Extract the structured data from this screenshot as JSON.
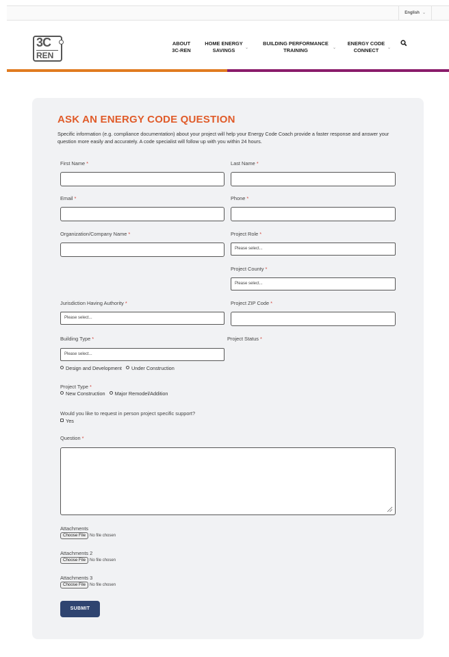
{
  "topbar": {
    "language": "English"
  },
  "header": {
    "logo": {
      "line1": "3C",
      "line2": "REN"
    },
    "nav": [
      {
        "line1": "ABOUT",
        "line2": "3C-REN"
      },
      {
        "line1": "HOME ENERGY",
        "line2": "SAVINGS"
      },
      {
        "line1": "BUILDING PERFORMANCE",
        "line2": "TRAINING"
      },
      {
        "line1": "ENERGY CODE",
        "line2": "CONNECT"
      }
    ]
  },
  "colors": {
    "accent_orange": "#e07b20",
    "accent_purple": "#8a1b6a",
    "title": "#e05b29",
    "submit": "#2f4470"
  },
  "form": {
    "title": "ASK AN ENERGY CODE QUESTION",
    "intro": "Specific information (e.g. compliance documentation) about your project will help your Energy Code Coach provide a faster response and answer your question more easily and accurately. A code specialist will follow up with you within 24 hours.",
    "required_mark": "*",
    "first_name": {
      "label": "First Name"
    },
    "last_name": {
      "label": "Last Name"
    },
    "email": {
      "label": "Email"
    },
    "phone": {
      "label": "Phone"
    },
    "organization": {
      "label": "Organization/Company Name"
    },
    "project_role": {
      "label": "Project Role",
      "value": "Please select..."
    },
    "project_county": {
      "label": "Project County",
      "value": "Please select..."
    },
    "jurisdiction": {
      "label": "Jurisdiction Having Authority",
      "value": "Please select..."
    },
    "project_zip": {
      "label": "Project ZIP Code"
    },
    "building_type": {
      "label": "Building Type",
      "value": "Please select..."
    },
    "project_status": {
      "label": "Project Status",
      "options": [
        "Design and Development",
        "Under Construction"
      ]
    },
    "project_type": {
      "label": "Project Type",
      "options": [
        "New Construction",
        "Major Remodel/Addition"
      ]
    },
    "support": {
      "label": "Would you like to request in person project specific support?",
      "option": "Yes"
    },
    "question": {
      "label": "Question"
    },
    "attachments": [
      {
        "label": "Attachments",
        "button": "Choose File",
        "status": "No file chosen"
      },
      {
        "label": "Attachments 2",
        "button": "Choose File",
        "status": "No file chosen"
      },
      {
        "label": "Attachments 3",
        "button": "Choose File",
        "status": "No file chosen"
      }
    ],
    "submit_label": "SUBMIT"
  }
}
